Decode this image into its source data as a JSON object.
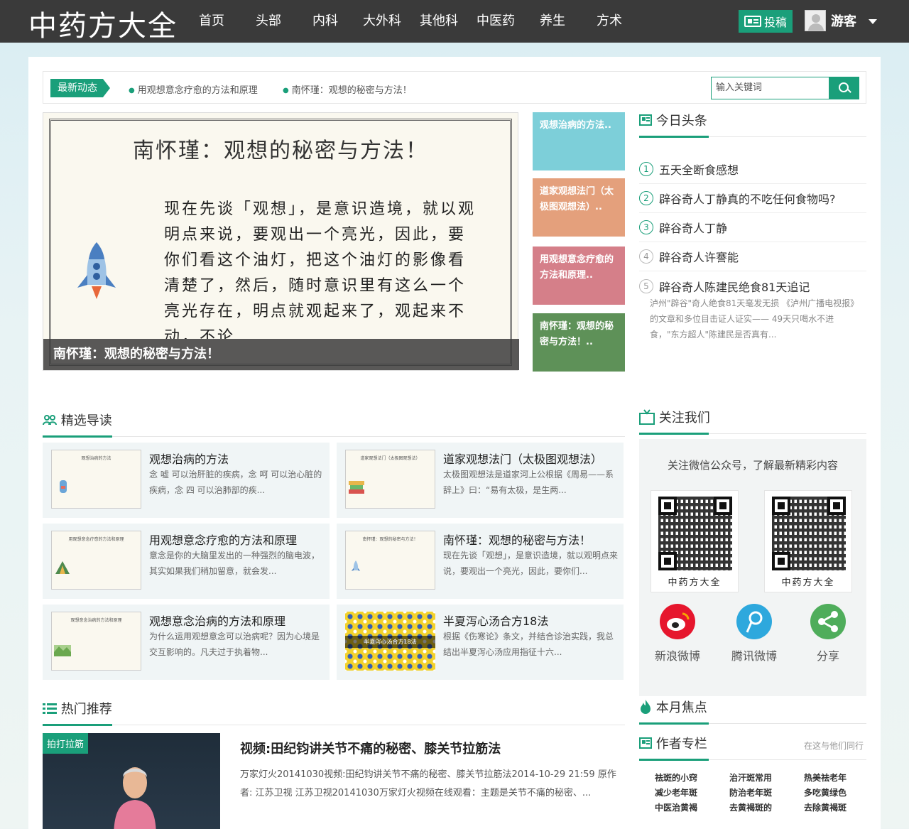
{
  "site": {
    "logo": "中药方大全"
  },
  "nav": [
    "首页",
    "头部",
    "内科",
    "大外科",
    "其他科",
    "中医药",
    "养生",
    "方术"
  ],
  "header_right": {
    "submit_label": "投稿",
    "user_name": "游客"
  },
  "newsbar": {
    "tag": "最新动态",
    "items": [
      "用观想意念疗愈的方法和原理",
      "南怀瑾：观想的秘密与方法！"
    ],
    "search_placeholder": "输入关键词"
  },
  "slider": {
    "title": "南怀瑾：观想的秘密与方法！",
    "body": "现在先谈「观想」，是意识造境，就以观明点来说，要观出一个亮光，因此，要你们看这个油灯，把这个油灯的影像看清楚了，然后，随时意识里有这么一个亮光存在，明点就观起来了，观起来不动，不论",
    "caption": "南怀瑾：观想的秘密与方法！"
  },
  "tiles": [
    {
      "label": "观想治病的方法..",
      "color": "#7dcfd9"
    },
    {
      "label": "道家观想法门（太极图观想法）..",
      "color": "#e4a07c"
    },
    {
      "label": "用观想意念疗愈的方法和原理..",
      "color": "#d57f89"
    },
    {
      "label": "南怀瑾：观想的秘密与方法！..",
      "color": "#5e9158"
    }
  ],
  "headlines": {
    "title": "今日头条",
    "items": [
      {
        "num": "1",
        "text": "五天全断食感想"
      },
      {
        "num": "2",
        "text": "辟谷奇人丁静真的不吃任何食物吗?"
      },
      {
        "num": "3",
        "text": "辟谷奇人丁静"
      },
      {
        "num": "4",
        "text": "辟谷奇人许謇能"
      },
      {
        "num": "5",
        "text": "辟谷奇人陈建民绝食81天追记"
      }
    ],
    "desc": "泸州\"辟谷\"奇人绝食81天毫发无损 《泸州广播电视报》的文章和多位目击证人证实—— 49天只喝水不进食，\"东方超人\"陈建民是否真有..."
  },
  "featured": {
    "title": "精选导读",
    "cards": [
      {
        "title": "观想治病的方法",
        "desc": "念 嘘 可以治肝脏的疾病，念 呵 可以治心脏的疾病，念 四 可以治肺部的疾...",
        "thumb_title": "观想治病的方法"
      },
      {
        "title": "道家观想法门（太极图观想法）",
        "desc": "太极图观想法是道家河上公根据《周易——系辞上》曰：“易有太极，是生两...",
        "thumb_title": "道家观想法门（太极图观想法）"
      },
      {
        "title": "用观想意念疗愈的方法和原理",
        "desc": "意念是你的大脑里发出的一种强烈的脑电波，其实如果我们稍加留意，就会发...",
        "thumb_title": "用观想意念疗愈的方法和原理"
      },
      {
        "title": "南怀瑾：观想的秘密与方法！",
        "desc": "现在先谈「观想」，是意识造境，就以观明点来说，要观出一个亮光，因此，要你们...",
        "thumb_title": "南怀瑾：观想的秘密与方法！"
      },
      {
        "title": "观想意念治病的方法和原理",
        "desc": "为什么运用观想意念可以治病呢？因为心境是交互影响的。凡夫过于执着物...",
        "thumb_title": "观想意念治病的方法和原理"
      },
      {
        "title": "半夏泻心汤合方18法",
        "desc": "根据《伤寒论》条文，并结合诊治实践，我总结出半夏泻心汤应用指征十六...",
        "thumb_title": "半夏泻心汤合方18法"
      }
    ]
  },
  "follow": {
    "title": "关注我们",
    "subtitle": "关注微信公众号，了解最新精彩内容",
    "qr_labels": [
      "中药方大全",
      "中药方大全"
    ],
    "social": [
      "新浪微博",
      "腾讯微博",
      "分享"
    ]
  },
  "hot": {
    "title": "热门推荐",
    "badge": "拍打拉筋",
    "headline": "视频:田纪钧讲关节不痛的秘密、膝关节拉筋法",
    "body": "万家灯火20141030视频:田纪钧讲关节不痛的秘密、膝关节拉筋法2014-10-29 21:59 原作者: 江苏卫视 江苏卫视20141030万家灯火视频在线观看：主题是关节不痛的秘密、..."
  },
  "focus": {
    "title": "本月焦点"
  },
  "authors": {
    "title": "作者专栏",
    "more": "在这与他们同行",
    "items": [
      "祛斑的小窍",
      "治汗斑常用",
      "热美祛老年",
      "减少老年斑",
      "防治老年斑",
      "多吃黄绿色",
      "中医治黄褐",
      "去黄褐斑的",
      "去除黄褐斑"
    ]
  }
}
